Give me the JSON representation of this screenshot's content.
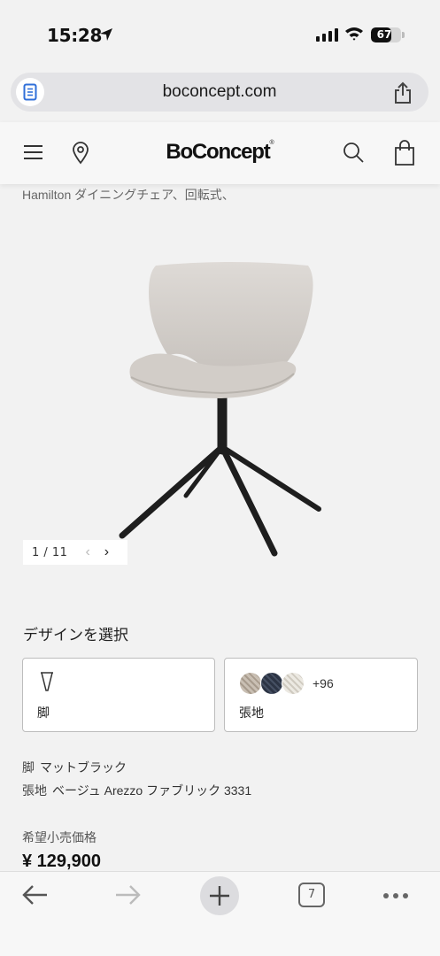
{
  "status_bar": {
    "time": "15:28",
    "battery": "67",
    "battery_level_percent": 67
  },
  "browser": {
    "url": "boconcept.com"
  },
  "site_header": {
    "logo": "BoConcept",
    "logo_mark": "®",
    "icons": [
      "menu-icon",
      "location-pin-icon",
      "search-icon",
      "shopping-bag-icon"
    ]
  },
  "product": {
    "subtitle": "Hamilton ダイニングチェア、回転式、",
    "gallery": {
      "pager": "1 / 11",
      "prev_icon": "chevron-left-icon",
      "next_icon": "chevron-right-icon"
    },
    "design_section_title": "デザインを選択",
    "options": [
      {
        "label": "脚",
        "icon": "leg-icon"
      },
      {
        "label": "張地",
        "swatch_count": "+96",
        "swatch_colors": [
          "#b8ada0",
          "#343c4d",
          "#e2ded6"
        ]
      }
    ],
    "specs": [
      {
        "key": "脚",
        "value": "マットブラック"
      },
      {
        "key": "張地",
        "value": "ベージュ Arezzo ファブリック 3331"
      }
    ],
    "price_label": "希望小売価格",
    "price": "¥ 129,900"
  },
  "toolbar": {
    "tabs_count": "7",
    "icons": [
      "back-arrow-icon",
      "forward-arrow-icon",
      "new-tab-plus-icon",
      "tabs-icon",
      "more-icon"
    ]
  },
  "colors": {
    "background": "#f2f2f2",
    "chair_fabric": "#d6d1cc",
    "chair_base": "#1e1e1e"
  }
}
